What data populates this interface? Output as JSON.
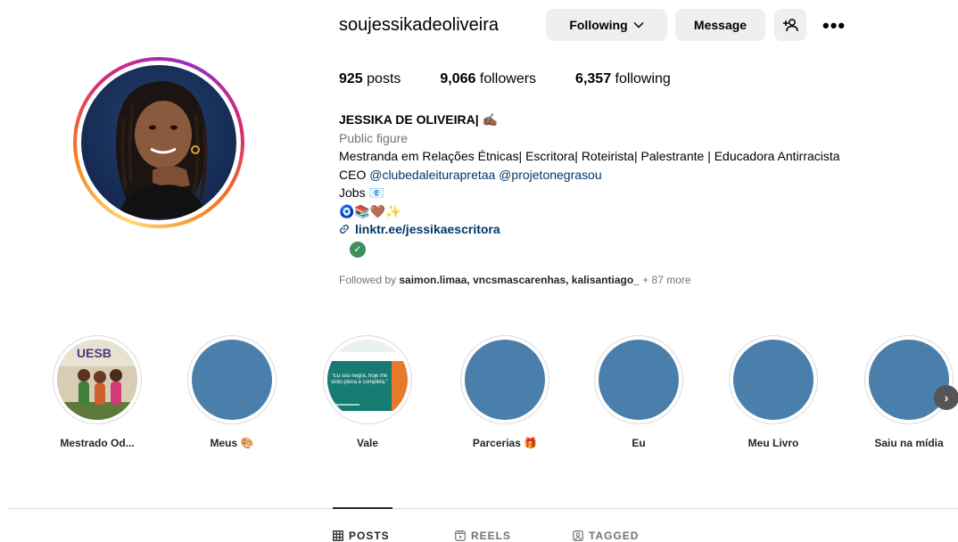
{
  "profile": {
    "username": "soujessikadeoliveira",
    "following_button": "Following",
    "message_button": "Message",
    "posts_count": "925",
    "posts_label": "posts",
    "followers_count": "9,066",
    "followers_label": "followers",
    "following_count": "6,357",
    "following_label": "following"
  },
  "bio": {
    "name": "JESSIKA DE OLIVEIRA| ✍🏾",
    "category": "Public figure",
    "line1": "Mestranda em Relações Étnicas| Escritora| Roteirista| Palestrante | Educadora Antirracista",
    "ceo_prefix": "CEO ",
    "mention1": "@clubedaleiturapretaa",
    "mention2": "@projetonegrasou",
    "jobs": "Jobs 📧",
    "emojis": "🧿📚🤎✨",
    "link": "linktr.ee/jessikaescritora"
  },
  "followed_by": {
    "prefix": "Followed by ",
    "users": "saimon.limaa, vncsmascarenhas, kalisantiago_",
    "more": " + 87 more"
  },
  "highlights": [
    {
      "label": "Mestrado Od..."
    },
    {
      "label": "Meus 🎨"
    },
    {
      "label": "Vale"
    },
    {
      "label": "Parcerias 🎁"
    },
    {
      "label": "Eu"
    },
    {
      "label": "Meu Livro"
    },
    {
      "label": "Saiu na mídia"
    }
  ],
  "highlight_images": {
    "uesb_text": "UESB",
    "vale_text": "\"Eu sou negra, hoje me sinto plena e completa.\""
  },
  "tabs": {
    "posts": "POSTS",
    "reels": "REELS",
    "tagged": "TAGGED"
  },
  "colors": {
    "highlight_placeholder": "#4a7fab",
    "link": "#00376b",
    "verified_check": "#3d8f5f"
  }
}
